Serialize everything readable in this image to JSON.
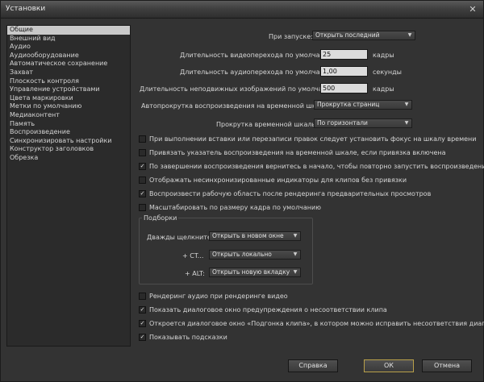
{
  "window": {
    "title": "Установки",
    "close_glyph": "✕"
  },
  "sidebar": {
    "items": [
      {
        "label": "Общие",
        "selected": true
      },
      {
        "label": "Внешний вид"
      },
      {
        "label": "Аудио"
      },
      {
        "label": "Аудиооборудование"
      },
      {
        "label": "Автоматическое сохранение"
      },
      {
        "label": "Захват"
      },
      {
        "label": "Плоскость контроля"
      },
      {
        "label": "Управление устройствами"
      },
      {
        "label": "Цвета маркировки"
      },
      {
        "label": "Метки по умолчанию"
      },
      {
        "label": "Медиаконтент"
      },
      {
        "label": "Память"
      },
      {
        "label": "Воспроизведение"
      },
      {
        "label": "Синхронизировать настройки"
      },
      {
        "label": "Конструктор заголовков"
      },
      {
        "label": "Обрезка"
      }
    ]
  },
  "general": {
    "startup_label": "При запуске:",
    "startup_value": "Открыть последний",
    "video_transition_label": "Длительность видеоперехода по умолчанию:",
    "video_transition_value": "25",
    "video_transition_unit": "кадры",
    "audio_transition_label": "Длительность аудиоперехода по умолчанию:",
    "audio_transition_value": "1,00",
    "audio_transition_unit": "секунды",
    "still_image_label": "Длительность неподвижных изображений по умолчанию:",
    "still_image_value": "500",
    "still_image_unit": "кадры",
    "autoscroll_label": "Автопрокрутка воспроизведения на временной шкале:",
    "autoscroll_value": "Прокрутка страниц",
    "timeline_scroll_label": "Прокрутка временной шкалы:",
    "timeline_scroll_value": "По горизонтали"
  },
  "checkboxes": [
    {
      "label": "При выполнении вставки или перезаписи правок следует установить фокус на шкалу времени",
      "checked": false
    },
    {
      "label": "Привязать указатель воспроизведения на временной шкале, если привязка включена",
      "checked": false
    },
    {
      "label": "По завершении воспроизведения вернитесь в начало, чтобы повторно запустить воспроизведение",
      "checked": true
    },
    {
      "label": "Отображать несинхронизированные индикаторы для клипов без привязки",
      "checked": false
    },
    {
      "label": "Воспроизвести рабочую область после рендеринга предварительных просмотров",
      "checked": true
    },
    {
      "label": "Масштабировать по размеру кадра по умолчанию",
      "checked": false
    }
  ],
  "bins": {
    "title": "Подборки",
    "double_click_label": "Дважды щелкните:",
    "double_click_value": "Открыть в новом окне",
    "ctrl_label": "+ CT...",
    "ctrl_value": "Открыть локально",
    "alt_label": "+ ALT:",
    "alt_value": "Открыть новую вкладку"
  },
  "checkboxes_bottom": [
    {
      "label": "Рендеринг аудио при рендеринге видео",
      "checked": false
    },
    {
      "label": "Показать диалоговое окно предупреждения о несоответствии клипа",
      "checked": true
    },
    {
      "label": "Откроется диалоговое окно «Подгонка клипа», в котором можно исправить несоответствия диапазона",
      "checked": true
    },
    {
      "label": "Показывать подсказки",
      "checked": true
    }
  ],
  "buttons": {
    "help": "Справка",
    "ok": "ОК",
    "cancel": "Отмена"
  },
  "glyphs": {
    "check": "✓",
    "dropdown_arrow": "▼"
  }
}
